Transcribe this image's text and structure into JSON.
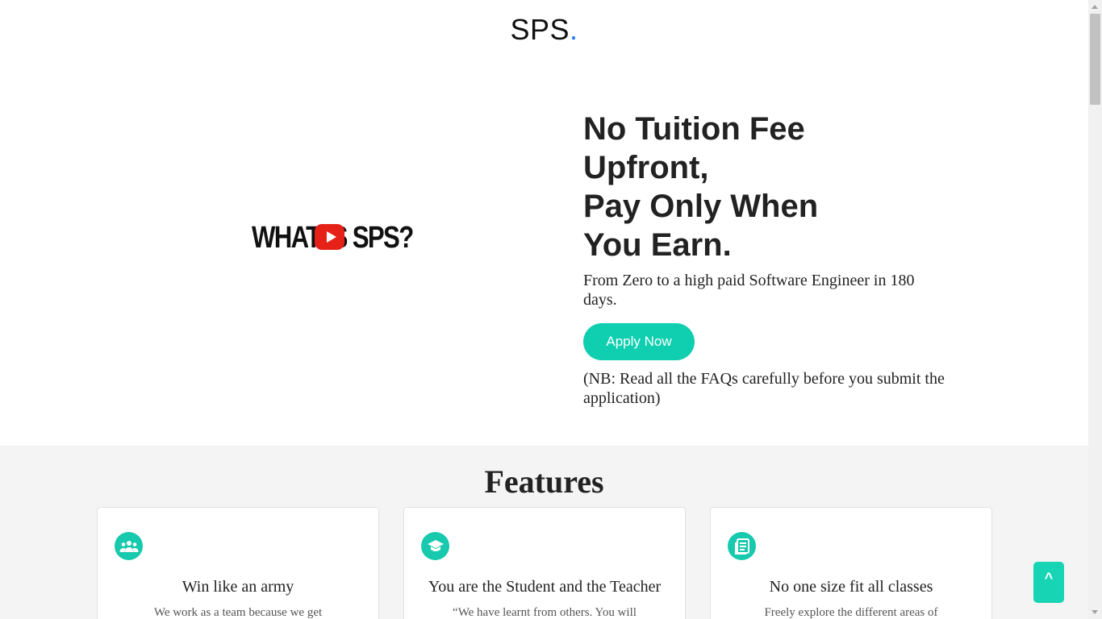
{
  "header": {
    "logo_text": "SPS",
    "logo_dot": "."
  },
  "hero": {
    "video_text": "WHAT IS SPS?",
    "title_lines": [
      "No Tuition Fee",
      "Upfront,",
      "Pay Only When",
      "You Earn."
    ],
    "subtitle": "From Zero to a high paid Software Engineer in 180 days.",
    "apply_label": "Apply Now",
    "note": "(NB: Read all the FAQs carefully before you submit the application)"
  },
  "features": {
    "title": "Features",
    "cards": [
      {
        "icon": "team-icon",
        "title": "Win like an army",
        "text": "We work as a team because we get"
      },
      {
        "icon": "graduation-cap-icon",
        "title": "You are the Student and the Teacher",
        "text": "“We have learnt from others. You will"
      },
      {
        "icon": "article-icon",
        "title": "No one size fit all classes",
        "text": "Freely explore the different areas of"
      }
    ]
  },
  "back_to_top": {
    "label": "^"
  },
  "colors": {
    "accent": "#17c9ad",
    "logo_dot": "#1a73e8",
    "play": "#e62117"
  }
}
